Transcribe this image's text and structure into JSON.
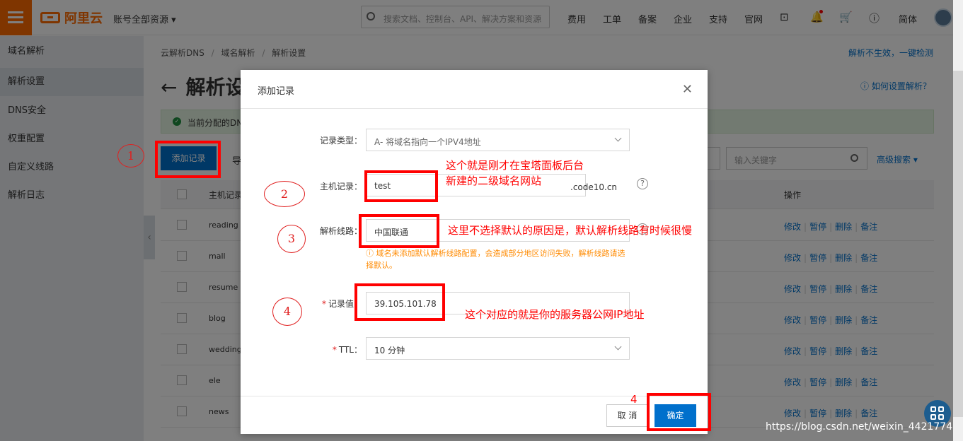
{
  "header": {
    "logo_text": "阿里云",
    "account_label": "账号全部资源",
    "search_placeholder": "搜索文档、控制台、API、解决方案和资源",
    "nav": [
      "费用",
      "工单",
      "备案",
      "企业",
      "支持",
      "官网"
    ],
    "lang": "简体",
    "icons": [
      "terminal-icon",
      "bell-icon",
      "cart-icon",
      "help-icon"
    ]
  },
  "sidebar": {
    "items": [
      {
        "label": "域名解析",
        "active": false
      },
      {
        "label": "解析设置",
        "active": true
      },
      {
        "label": "DNS安全",
        "active": false
      },
      {
        "label": "权重配置",
        "active": false
      },
      {
        "label": "自定义线路",
        "active": false
      },
      {
        "label": "解析日志",
        "active": false
      }
    ]
  },
  "breadcrumb": [
    "云解析DNS",
    "域名解析",
    "解析设置"
  ],
  "help_link": "解析不生效，一键检测",
  "page_title": "解析设",
  "how_link": "如何设置解析？",
  "notice": "当前分配的DNS",
  "toolbar": {
    "add_label": "添加记录",
    "export_label": "导",
    "keyword_placeholder": "输入关键字",
    "advanced_label": "高级搜索"
  },
  "table": {
    "col_host": "主机记录",
    "col_ops": "操作",
    "ops": [
      "修改",
      "暂停",
      "删除",
      "备注"
    ],
    "rows": [
      "reading",
      "mall",
      "resume",
      "blog",
      "wedding",
      "ele",
      "news"
    ]
  },
  "modal": {
    "title": "添加记录",
    "type_label": "记录类型：",
    "type_value": "A- 将域名指向一个IPV4地址",
    "host_label": "主机记录：",
    "host_value": "test",
    "host_suffix": ".code10.cn",
    "line_label": "解析线路：",
    "line_value": "中国联通",
    "warning": "域名未添加默认解析线路配置，会造成部分地区访问失败，解析线路请选择默认。",
    "value_label": "记录值：",
    "value_value": "39.105.101.78",
    "ttl_label": "TTL：",
    "ttl_value": "10 分钟",
    "cancel_label": "取 消",
    "ok_label": "确定"
  },
  "annotations": {
    "step1": "1",
    "step2": "2",
    "step3": "3",
    "step4a": "4",
    "step4b": "4",
    "note_host_1": "这个就是刚才在宝塔面板后台",
    "note_host_2": "新建的二级域名网站",
    "note_line": "这里不选择默认的原因是，默认解析线路有时候很慢",
    "note_value": "这个对应的就是你的服务器公网IP地址"
  },
  "watermark": "https://blog.csdn.net/weixin_4421774",
  "colors": {
    "brand": "#ff6a00",
    "primary": "#0070cc",
    "annotation": "#ff0000"
  }
}
